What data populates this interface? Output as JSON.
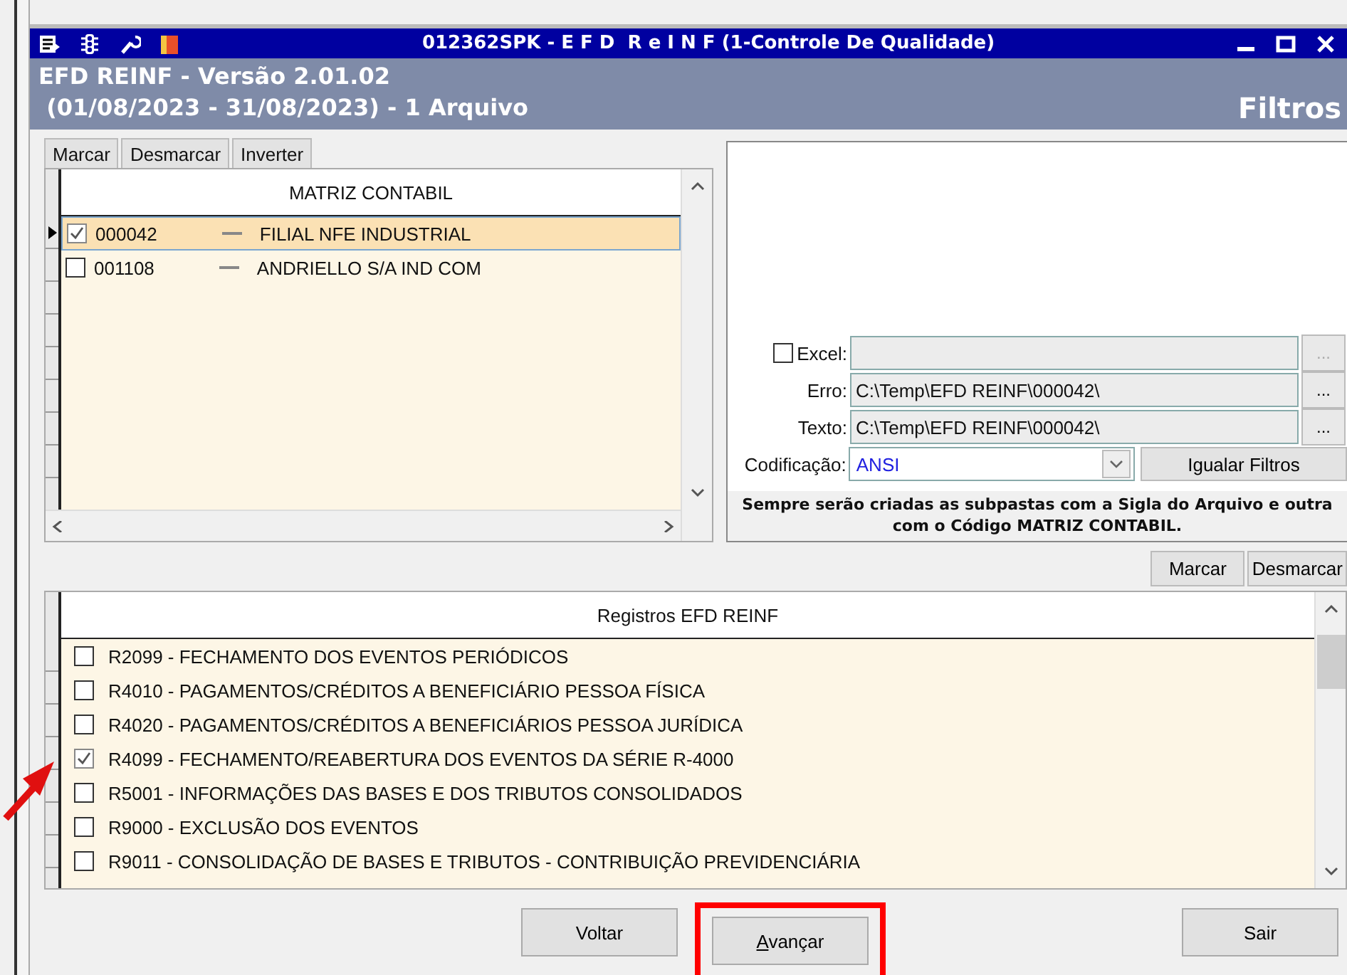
{
  "window": {
    "title": "012362SPK - E F D  R e I N F (1-Controle De Qualidade)"
  },
  "header": {
    "line_1": "EFD REINF - Versão 2.01.02",
    "line_2": " (01/08/2023 - 31/08/2023) - 1 Arquivo",
    "page_title": "Filtros"
  },
  "tabs": [
    {
      "label": "Marcar"
    },
    {
      "label": "Desmarcar"
    },
    {
      "label": "Inverter"
    }
  ],
  "company_grid": {
    "column": "MATRIZ CONTABIL",
    "rows": [
      {
        "code": "000042",
        "name": "FILIAL NFE INDUSTRIAL",
        "checked": true,
        "selected": true
      },
      {
        "code": "001108",
        "name": "ANDRIELLO S/A IND COM",
        "checked": false,
        "selected": false
      }
    ]
  },
  "output": {
    "excel": {
      "label": "Excel:",
      "checked": false,
      "disabled": true
    },
    "fields": [
      {
        "label": "Erro:",
        "value": "C:\\Temp\\EFD REINF\\000042\\",
        "button": "..."
      },
      {
        "label": "Texto:",
        "value": "C:\\Temp\\EFD REINF\\000042\\",
        "button": "..."
      }
    ],
    "excel_button": "...",
    "encoding": {
      "label": "Codificação:",
      "value": "ANSI"
    },
    "match_button": "Igualar Filtros",
    "note": "Sempre serão criadas as subpastas com a Sigla do Arquivo e outra com o Código MATRIZ CONTABIL."
  },
  "record_buttons": [
    "Marcar",
    "Desmarcar"
  ],
  "records_grid": {
    "column": "Registros EFD REINF",
    "rows": [
      {
        "label": "R2099 - FECHAMENTO DOS EVENTOS PERIÓDICOS",
        "checked": false,
        "arrow_pointer": false
      },
      {
        "label": "R4010 - PAGAMENTOS/CRÉDITOS A BENEFICIÁRIO PESSOA FÍSICA",
        "checked": false,
        "arrow_pointer": false
      },
      {
        "label": "R4020 - PAGAMENTOS/CRÉDITOS A BENEFICIÁRIOS PESSOA JURÍDICA",
        "checked": false,
        "arrow_pointer": false
      },
      {
        "label": "R4099 - FECHAMENTO/REABERTURA DOS EVENTOS DA SÉRIE R-4000",
        "checked": true,
        "arrow_pointer": true
      },
      {
        "label": "R5001 - INFORMAÇÕES DAS BASES E DOS TRIBUTOS CONSOLIDADOS",
        "checked": false,
        "arrow_pointer": false
      },
      {
        "label": "R9000 - EXCLUSÃO DOS EVENTOS",
        "checked": false,
        "arrow_pointer": false
      },
      {
        "label": "R9011 - CONSOLIDAÇÃO DE BASES E TRIBUTOS - CONTRIBUIÇÃO PREVIDENCIÁRIA",
        "checked": false,
        "arrow_pointer": false
      }
    ]
  },
  "footer_buttons": [
    {
      "label": "Voltar",
      "highlighted": false,
      "accelerator": false
    },
    {
      "label": "Avançar",
      "highlighted": true,
      "accelerator": true
    },
    {
      "label": "Sair",
      "highlighted": false,
      "accelerator": false
    }
  ]
}
